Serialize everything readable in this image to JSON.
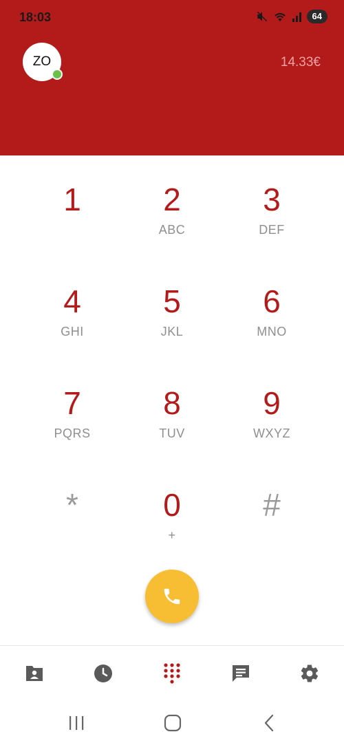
{
  "status_bar": {
    "time": "18:03",
    "battery": "64",
    "icons": [
      "mute-icon",
      "wifi-icon",
      "signal-icon"
    ]
  },
  "header": {
    "avatar_initials": "ZO",
    "presence": "online",
    "balance": "14.33€"
  },
  "keypad": {
    "keys": [
      {
        "digit": "1",
        "letters": ""
      },
      {
        "digit": "2",
        "letters": "ABC"
      },
      {
        "digit": "3",
        "letters": "DEF"
      },
      {
        "digit": "4",
        "letters": "GHI"
      },
      {
        "digit": "5",
        "letters": "JKL"
      },
      {
        "digit": "6",
        "letters": "MNO"
      },
      {
        "digit": "7",
        "letters": "PQRS"
      },
      {
        "digit": "8",
        "letters": "TUV"
      },
      {
        "digit": "9",
        "letters": "WXYZ"
      },
      {
        "digit": "*",
        "letters": ""
      },
      {
        "digit": "0",
        "letters": "+"
      },
      {
        "digit": "#",
        "letters": ""
      }
    ]
  },
  "call_button": {
    "icon": "phone-icon"
  },
  "bottom_nav": {
    "items": [
      {
        "icon": "contacts-icon"
      },
      {
        "icon": "clock-icon"
      },
      {
        "icon": "dialpad-icon",
        "active": true
      },
      {
        "icon": "chat-icon"
      },
      {
        "icon": "gear-icon"
      }
    ]
  },
  "colors": {
    "brand_red": "#B31B1B",
    "balance_text": "#F1A3A3",
    "call_yellow": "#F7BE33",
    "presence_green": "#6CC04A",
    "nav_gray": "#5a5a5a"
  },
  "system_nav": {
    "icons": [
      "recents-icon",
      "home-icon",
      "back-icon"
    ]
  }
}
